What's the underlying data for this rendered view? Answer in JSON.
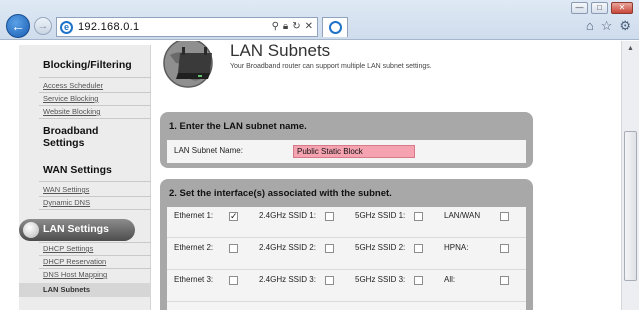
{
  "browser": {
    "address": "192.168.0.1",
    "addr_icons": [
      "search-icon",
      "lock-icon",
      "refresh-icon",
      "stop-icon"
    ],
    "toolbar_icons": [
      "home-icon",
      "favorites-star-icon",
      "settings-gear-icon"
    ]
  },
  "sidebar": {
    "groups": [
      {
        "heading": "Blocking/Filtering",
        "links": [
          "Access Scheduler",
          "Service Blocking",
          "Website Blocking"
        ]
      },
      {
        "heading": "Broadband Settings",
        "links": []
      },
      {
        "heading": "WAN Settings",
        "links": [
          "WAN Settings",
          "Dynamic DNS"
        ]
      },
      {
        "heading": "LAN Settings",
        "links": [
          "DHCP Settings",
          "DHCP Reservation",
          "DNS Host Mapping",
          "LAN Subnets"
        ]
      }
    ]
  },
  "page": {
    "title": "LAN Subnets",
    "subtitle": "Your Broadband router can support multiple LAN subnet settings."
  },
  "section1": {
    "title": "1. Enter the LAN subnet name.",
    "label": "LAN Subnet Name:",
    "value": "Public Static Block"
  },
  "section2": {
    "title": "2. Set the interface(s) associated with the subnet.",
    "rows": [
      {
        "eth": "Ethernet 1:",
        "eth_checked": true,
        "g24": "2.4GHz SSID 1:",
        "g5": "5GHz SSID 1:",
        "other": "LAN/WAN"
      },
      {
        "eth": "Ethernet 2:",
        "eth_checked": false,
        "g24": "2.4GHz SSID 2:",
        "g5": "5GHz SSID 2:",
        "other": "HPNA:"
      },
      {
        "eth": "Ethernet 3:",
        "eth_checked": false,
        "g24": "2.4GHz SSID 3:",
        "g5": "5GHz SSID 3:",
        "other": "All:"
      }
    ]
  }
}
